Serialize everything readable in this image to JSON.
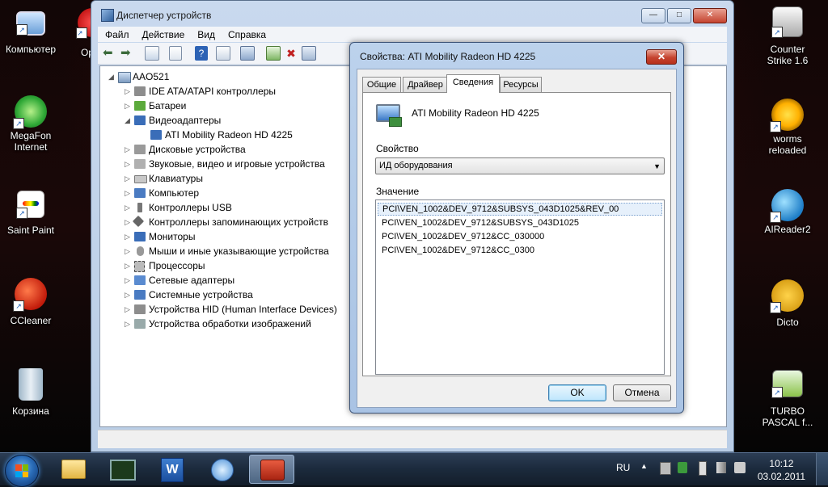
{
  "desktop": {
    "left_icons": [
      {
        "label": "Компьютер"
      },
      {
        "label": "MegaFon Internet"
      },
      {
        "label": "Saint Paint"
      },
      {
        "label": "CCleaner"
      },
      {
        "label": "Корзина"
      }
    ],
    "partial_icon": {
      "label": "Ор"
    },
    "right_icons": [
      {
        "label": "Counter Strike 1.6"
      },
      {
        "label": "worms reloaded"
      },
      {
        "label": "AIReader2"
      },
      {
        "label": "Dicto"
      },
      {
        "label": "TURBO PASCAL f..."
      }
    ]
  },
  "device_manager": {
    "title": "Диспетчер устройств",
    "caption_buttons": {
      "minimize": "—",
      "maximize": "□",
      "close": "✕"
    },
    "menu": [
      "Файл",
      "Действие",
      "Вид",
      "Справка"
    ],
    "toolbar_icons": [
      "back-icon",
      "forward-icon",
      "console-tree-icon",
      "properties-icon",
      "help-icon",
      "view-icon",
      "scan-hardware-icon",
      "update-driver-icon",
      "disable-device-icon",
      "uninstall-device-icon"
    ],
    "tree": {
      "root": "AAO521",
      "items": [
        {
          "label": "IDE ATA/ATAPI контроллеры",
          "icon": "ide-controller-icon"
        },
        {
          "label": "Батареи",
          "icon": "battery-icon"
        },
        {
          "label": "Видеоадаптеры",
          "icon": "display-adapter-icon",
          "expanded": true
        },
        {
          "label": "ATI Mobility Radeon HD 4225",
          "icon": "display-adapter-icon",
          "child": true
        },
        {
          "label": "Дисковые устройства",
          "icon": "disk-drive-icon"
        },
        {
          "label": "Звуковые, видео и игровые устройства",
          "icon": "sound-icon"
        },
        {
          "label": "Клавиатуры",
          "icon": "keyboard-icon"
        },
        {
          "label": "Компьютер",
          "icon": "computer-icon"
        },
        {
          "label": "Контроллеры USB",
          "icon": "usb-icon"
        },
        {
          "label": "Контроллеры запоминающих устройств",
          "icon": "storage-controller-icon"
        },
        {
          "label": "Мониторы",
          "icon": "monitor-icon"
        },
        {
          "label": "Мыши и иные указывающие устройства",
          "icon": "mouse-icon"
        },
        {
          "label": "Процессоры",
          "icon": "processor-icon"
        },
        {
          "label": "Сетевые адаптеры",
          "icon": "network-adapter-icon"
        },
        {
          "label": "Системные устройства",
          "icon": "system-devices-icon"
        },
        {
          "label": "Устройства HID (Human Interface Devices)",
          "icon": "hid-icon"
        },
        {
          "label": "Устройства обработки изображений",
          "icon": "imaging-device-icon"
        }
      ]
    }
  },
  "properties_dialog": {
    "title": "Свойства: ATI Mobility Radeon HD 4225",
    "close_symbol": "✕",
    "tabs": [
      "Общие",
      "Драйвер",
      "Сведения",
      "Ресурсы"
    ],
    "active_tab": "Сведения",
    "device_name": "ATI Mobility Radeon HD 4225",
    "property_label": "Свойство",
    "property_value": "ИД оборудования",
    "value_label": "Значение",
    "values": [
      "PCI\\VEN_1002&DEV_9712&SUBSYS_043D1025&REV_00",
      "PCI\\VEN_1002&DEV_9712&SUBSYS_043D1025",
      "PCI\\VEN_1002&DEV_9712&CC_030000",
      "PCI\\VEN_1002&DEV_9712&CC_0300"
    ],
    "ok_label": "OK",
    "cancel_label": "Отмена"
  },
  "taskbar": {
    "items": [
      "explorer-icon",
      "device-monitor-icon",
      "word-icon",
      "media-icon",
      "device-manager-icon"
    ],
    "active_index": 4,
    "language": "RU",
    "time": "10:12",
    "date": "03.02.2011"
  }
}
